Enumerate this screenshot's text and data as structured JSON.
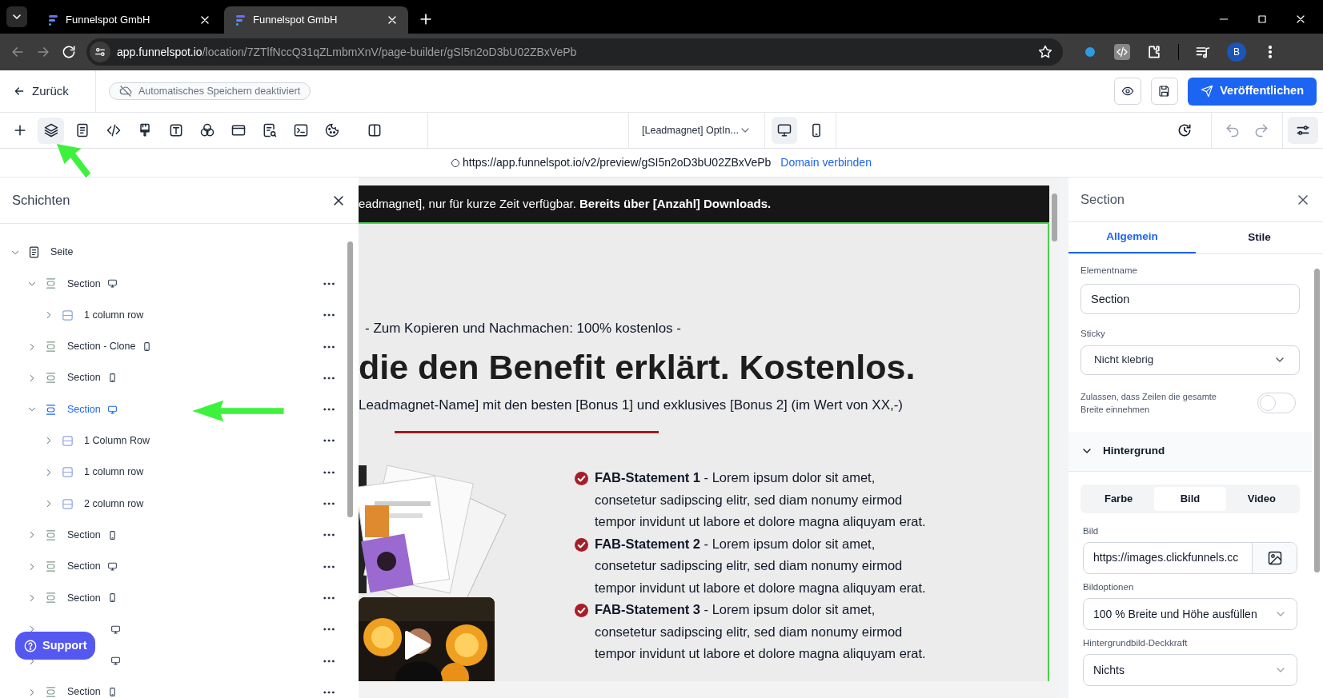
{
  "browser": {
    "tabs": [
      {
        "title": "Funnelspot GmbH",
        "selected": false
      },
      {
        "title": "Funnelspot GmbH",
        "selected": true
      }
    ],
    "address": {
      "host": "app.funnelspot.io",
      "path": "/location/7ZTlfNccQ31qZLmbmXnV/page-builder/gSI5n2oD3bU02ZBxVePb"
    },
    "profile_initial": "B"
  },
  "header": {
    "back": "Zurück",
    "autosave": "Automatisches Speichern deaktiviert",
    "publish": "Veröffentlichen"
  },
  "toolbar": {
    "tools": [
      {
        "kind": "add",
        "selected": false
      },
      {
        "kind": "layers",
        "selected": true
      },
      {
        "kind": "page",
        "selected": false
      },
      {
        "kind": "code",
        "selected": false
      },
      {
        "kind": "brush",
        "selected": false
      },
      {
        "kind": "text",
        "selected": false
      },
      {
        "kind": "circles",
        "selected": false
      },
      {
        "kind": "window",
        "selected": false
      },
      {
        "kind": "search-doc",
        "selected": false
      },
      {
        "kind": "terminal",
        "selected": false
      },
      {
        "kind": "cookie",
        "selected": false
      },
      {
        "kind": "columns",
        "selected": false
      }
    ],
    "page_select": "[Leadmagnet] OptIn...",
    "devices": [
      {
        "kind": "desktop",
        "selected": true
      },
      {
        "kind": "mobile",
        "selected": false
      }
    ]
  },
  "preview_bar": {
    "url": "https://app.funnelspot.io/v2/preview/gSI5n2oD3bU02ZBxVePb",
    "link": "Domain verbinden"
  },
  "layers": {
    "title": "Schichten",
    "tree": [
      {
        "label": "Seite",
        "kind": "page",
        "expanded": true,
        "selected": false,
        "children": [
          {
            "label": "Section",
            "kind": "section",
            "mobile_only": false,
            "expanded": true,
            "selected": false,
            "children": [
              {
                "label": "1 column row",
                "kind": "row",
                "expanded": false,
                "selected": false
              }
            ]
          },
          {
            "label": "Section - Clone",
            "kind": "section",
            "mobile_only": true,
            "expanded": false,
            "selected": false
          },
          {
            "label": "Section",
            "kind": "section",
            "mobile_only": true,
            "expanded": false,
            "selected": false
          },
          {
            "label": "Section",
            "kind": "section",
            "mobile_only": false,
            "expanded": true,
            "selected": true,
            "children": [
              {
                "label": "1 Column Row",
                "kind": "row",
                "expanded": false,
                "selected": false
              },
              {
                "label": "1 column row",
                "kind": "row",
                "expanded": false,
                "selected": false
              },
              {
                "label": "2 column row",
                "kind": "row",
                "expanded": false,
                "selected": false
              }
            ]
          },
          {
            "label": "Section",
            "kind": "section",
            "mobile_only": true,
            "expanded": false,
            "selected": false
          },
          {
            "label": "Section",
            "kind": "section",
            "mobile_only": false,
            "expanded": false,
            "selected": false
          },
          {
            "label": "Section",
            "kind": "section",
            "mobile_only": true,
            "expanded": false,
            "selected": false
          },
          {
            "kind": "section",
            "mobile_only": false,
            "expanded": false,
            "selected": false
          },
          {
            "kind": "section",
            "mobile_only": false,
            "expanded": false,
            "selected": false
          },
          {
            "label": "Section",
            "kind": "section",
            "mobile_only": true,
            "expanded": false,
            "selected": false
          }
        ]
      }
    ],
    "support": "Support"
  },
  "canvas": {
    "banner": "eadmagnet], nur für kurze Zeit verfügbar. **Bereits über [Anzahl] Downloads.**",
    "kicker": "- Zum Kopieren und Nachmachen: 100% kostenlos -",
    "headline": "die den Benefit erklärt. Kostenlos.",
    "subline": "Leadmagnet-Name] mit den besten [Bonus 1] und exklusives [Bonus 2] (im Wert von XX,-)",
    "bullets": [
      "**FAB-Statement 1** - Lorem ipsum dolor sit amet, consetetur sadipscing elitr, sed diam nonumy eirmod tempor invidunt ut labore et dolore magna aliquyam erat.",
      "**FAB-Statement 2** - Lorem ipsum dolor sit amet, consetetur sadipscing elitr, sed diam nonumy eirmod tempor invidunt ut labore et dolore magna aliquyam erat.",
      "**FAB-Statement 3** - Lorem ipsum dolor sit amet, consetetur sadipscing elitr, sed diam nonumy eirmod tempor invidunt ut labore et dolore magna aliquyam erat."
    ]
  },
  "properties": {
    "title": "Section",
    "tabs": [
      {
        "label": "Allgemein",
        "selected": true
      },
      {
        "label": "Stile",
        "selected": false
      }
    ],
    "element_name": {
      "label": "Elementname",
      "value": "Section"
    },
    "sticky": {
      "label": "Sticky",
      "value": "Nicht klebrig"
    },
    "full_width": {
      "label": "Zulassen, dass Zeilen die gesamte Breite einnehmen",
      "on": false
    },
    "background": {
      "title": "Hintergrund",
      "expanded": true,
      "modes": [
        {
          "label": "Farbe",
          "selected": false
        },
        {
          "label": "Bild",
          "selected": true
        },
        {
          "label": "Video",
          "selected": false
        }
      ],
      "image": {
        "label": "Bild",
        "value": "https://images.clickfunnels.cc"
      },
      "image_options": {
        "label": "Bildoptionen",
        "value": "100 % Breite und Höhe ausfüllen"
      },
      "opacity": {
        "label": "Hintergrundbild-Deckkraft",
        "value": "Nichts"
      }
    }
  }
}
